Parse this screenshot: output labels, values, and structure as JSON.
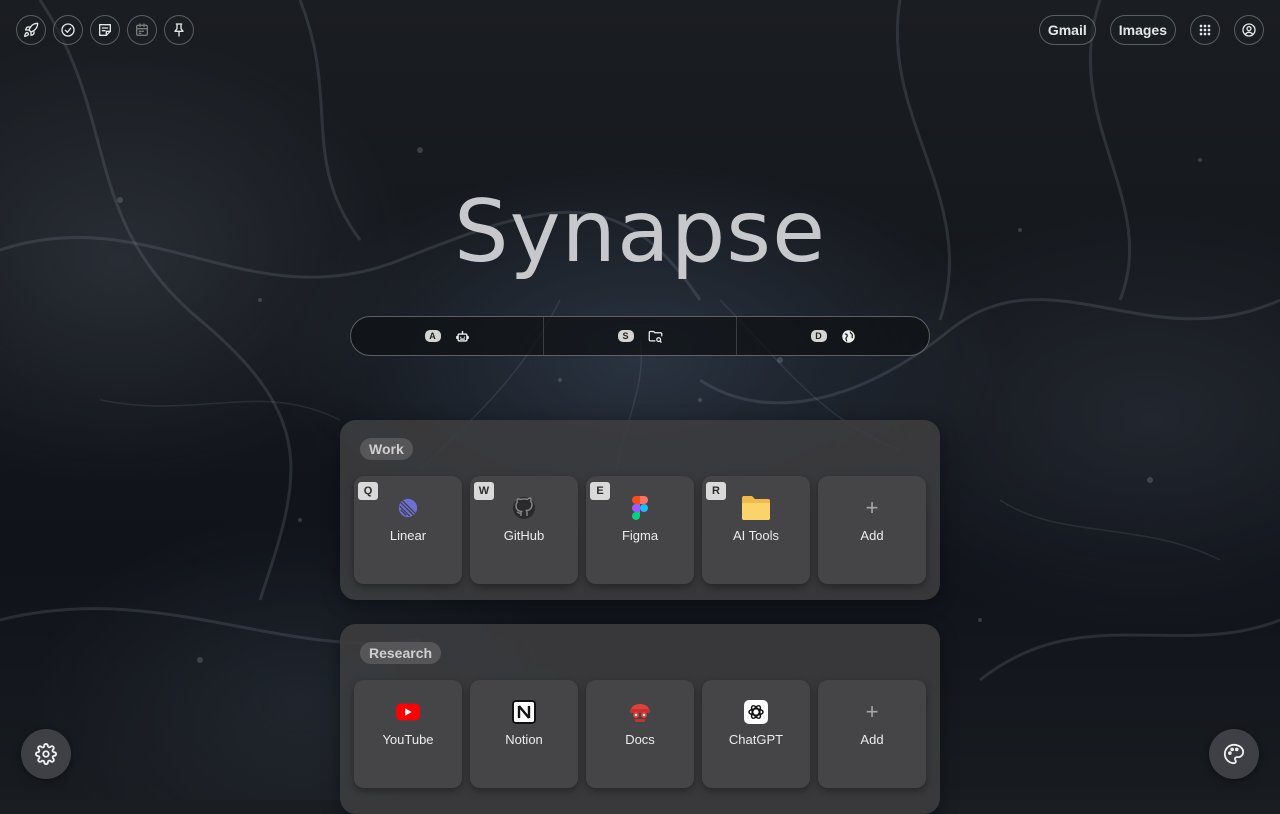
{
  "title": "Synapse",
  "toolbar_left": [
    {
      "icon": "rocket-icon"
    },
    {
      "icon": "check-circle-icon"
    },
    {
      "icon": "notes-icon"
    },
    {
      "icon": "calendar-icon"
    },
    {
      "icon": "pin-icon"
    }
  ],
  "toolbar_right": {
    "gmail_label": "Gmail",
    "images_label": "Images",
    "apps_icon": "grid-icon",
    "account_icon": "user-circle-icon"
  },
  "search_modes": [
    {
      "key": "A",
      "icon": "robot-icon"
    },
    {
      "key": "S",
      "icon": "folder-search-icon"
    },
    {
      "key": "D",
      "icon": "globe-icon"
    }
  ],
  "groups": [
    {
      "label": "Work",
      "tiles": [
        {
          "key": "Q",
          "label": "Linear",
          "icon": "linear-icon"
        },
        {
          "key": "W",
          "label": "GitHub",
          "icon": "github-icon"
        },
        {
          "key": "E",
          "label": "Figma",
          "icon": "figma-icon"
        },
        {
          "key": "R",
          "label": "AI Tools",
          "icon": "folder-icon"
        },
        {
          "key": "",
          "label": "Add",
          "icon": "plus-icon"
        }
      ]
    },
    {
      "label": "Research",
      "tiles": [
        {
          "key": "",
          "label": "YouTube",
          "icon": "youtube-icon"
        },
        {
          "key": "",
          "label": "Notion",
          "icon": "notion-icon"
        },
        {
          "key": "",
          "label": "Docs",
          "icon": "docs-icon"
        },
        {
          "key": "",
          "label": "ChatGPT",
          "icon": "chatgpt-icon"
        },
        {
          "key": "",
          "label": "Add",
          "icon": "plus-icon"
        }
      ]
    }
  ],
  "fabs": {
    "settings_icon": "gear-icon",
    "theme_icon": "palette-icon"
  },
  "colors": {
    "background": "#14171c",
    "card": "#3e3e40",
    "tile": "#464648",
    "accent_youtube": "#ff0000"
  }
}
